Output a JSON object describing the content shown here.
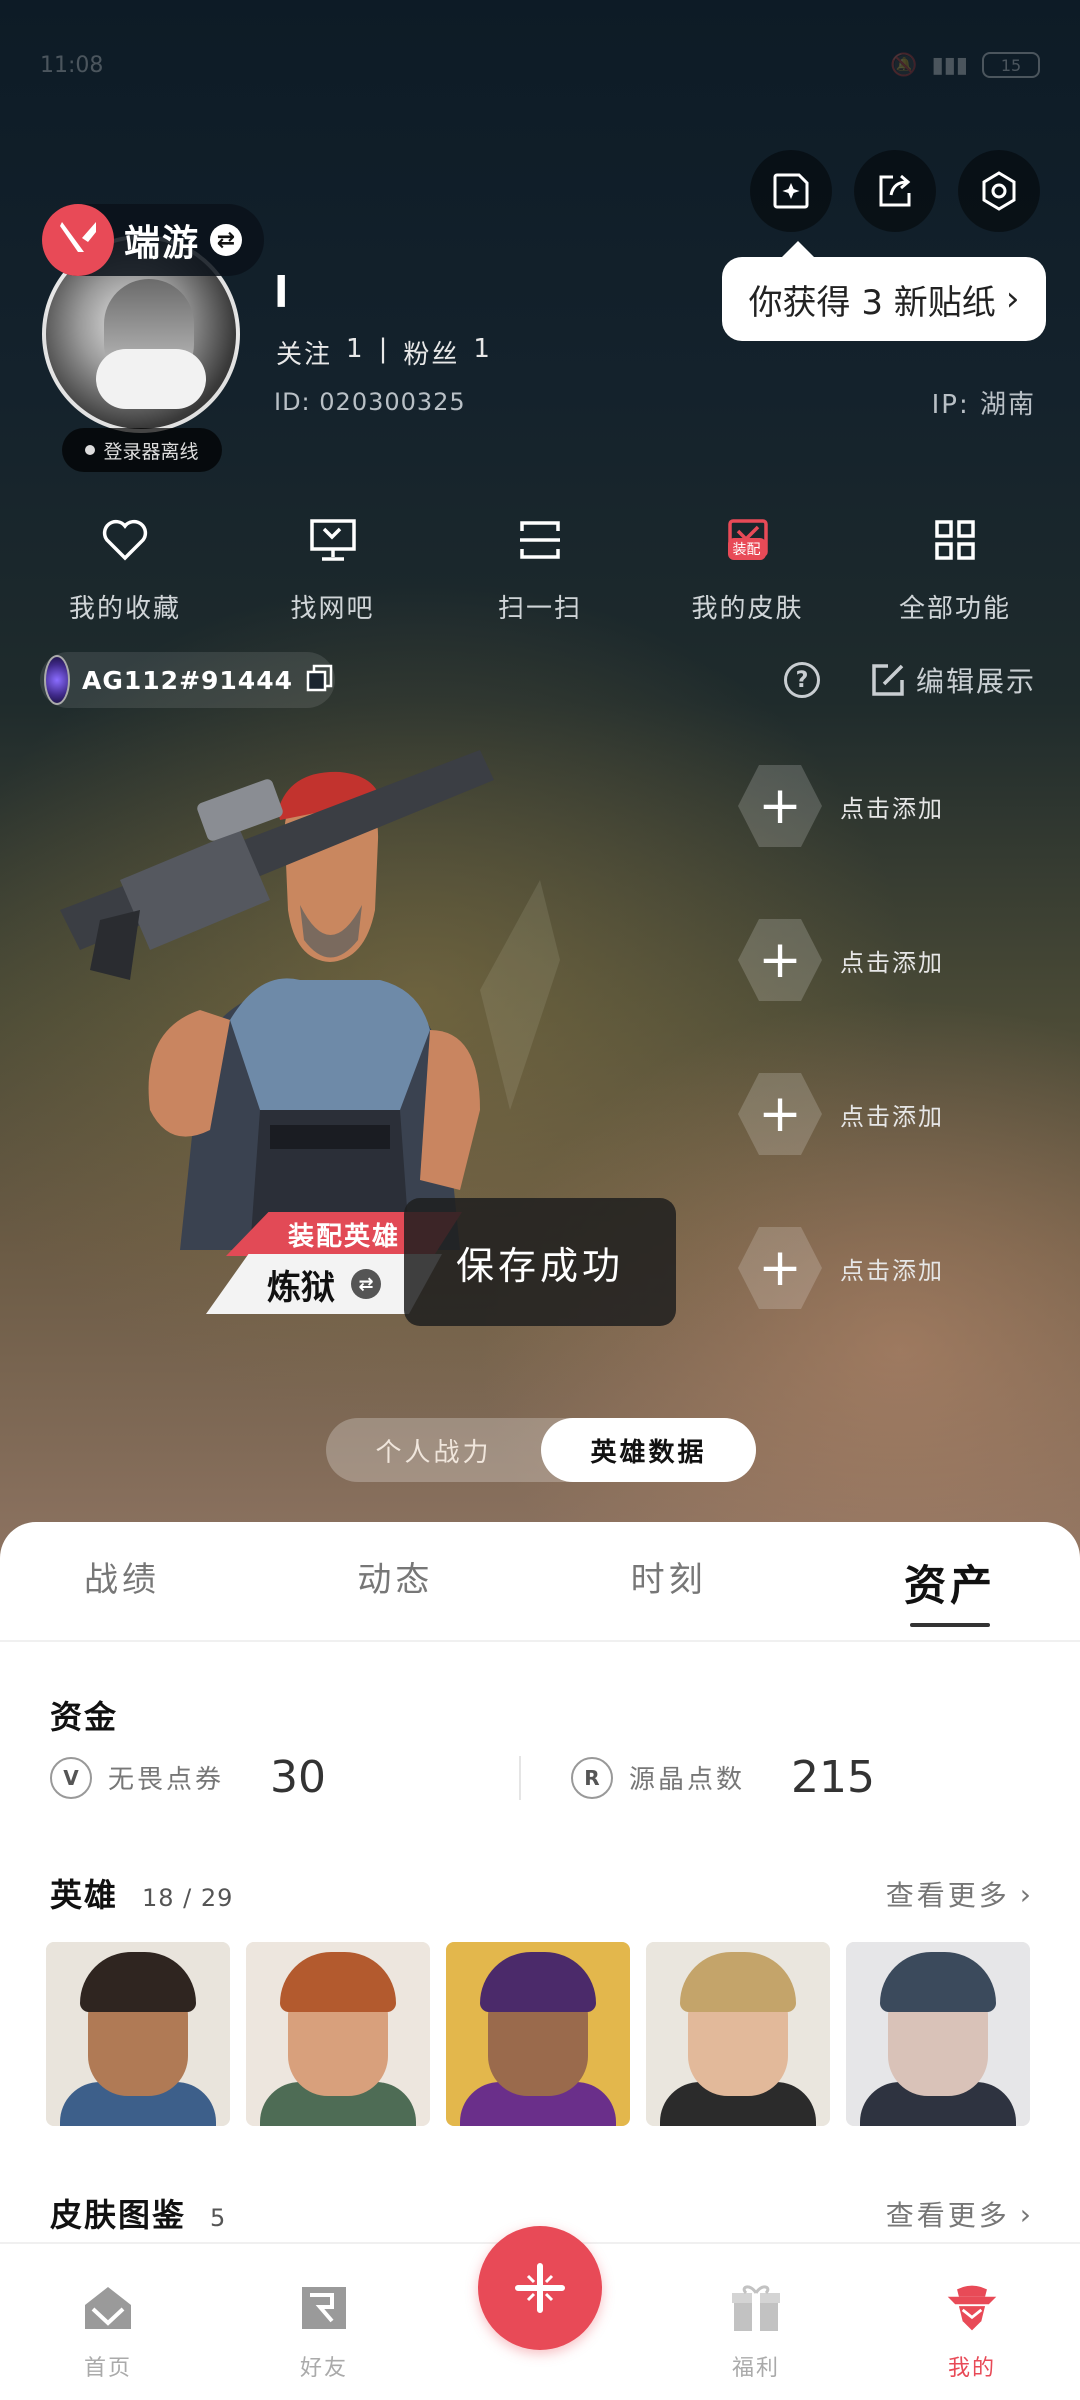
{
  "status_bar": {
    "time": "11:08",
    "battery": "15"
  },
  "app": {
    "name": "端游"
  },
  "sticker_tip": {
    "text": "你获得 3 新贴纸"
  },
  "profile": {
    "nickname": "l",
    "follow_label": "关注",
    "follow_count": "1",
    "fans_label": "粉丝",
    "fans_count": "1",
    "id_text": "ID: 020300325",
    "ip_text": "IP: 湖南",
    "login_status": "登录器离线"
  },
  "quick_functions": [
    {
      "label": "我的收藏",
      "icon": "heart-icon"
    },
    {
      "label": "找网吧",
      "icon": "monitor-icon"
    },
    {
      "label": "扫一扫",
      "icon": "scan-icon"
    },
    {
      "label": "我的皮肤",
      "icon": "skin-icon",
      "badge": "装配"
    },
    {
      "label": "全部功能",
      "icon": "grid-icon"
    }
  ],
  "riot_id": {
    "text": "AG112#91444"
  },
  "edit_display": {
    "label": "编辑展示"
  },
  "showcase": {
    "slot_label": "点击添加",
    "equip_tag": "装配英雄",
    "agent_name": "炼狱",
    "toast": "保存成功"
  },
  "stat_toggle": {
    "left": "个人战力",
    "right": "英雄数据",
    "active": "right"
  },
  "tabs": [
    {
      "label": "战绩"
    },
    {
      "label": "动态"
    },
    {
      "label": "时刻"
    },
    {
      "label": "资产",
      "active": true
    }
  ],
  "funds": {
    "title": "资金",
    "items": [
      {
        "icon": "valorant-points-icon",
        "label": "无畏点券",
        "value": "30"
      },
      {
        "icon": "radianite-icon",
        "label": "源晶点数",
        "value": "215"
      }
    ]
  },
  "heroes": {
    "title": "英雄",
    "count": "18 / 29",
    "see_more": "查看更多"
  },
  "skins": {
    "title": "皮肤图鉴",
    "count": "5",
    "see_more": "查看更多"
  },
  "colors": {
    "accent": "#e84a57"
  },
  "bottom_nav": [
    {
      "label": "首页",
      "icon": "home-icon"
    },
    {
      "label": "好友",
      "icon": "friends-icon"
    },
    {
      "label": "福利",
      "icon": "gift-icon"
    },
    {
      "label": "我的",
      "icon": "agent-icon",
      "active": true
    }
  ]
}
